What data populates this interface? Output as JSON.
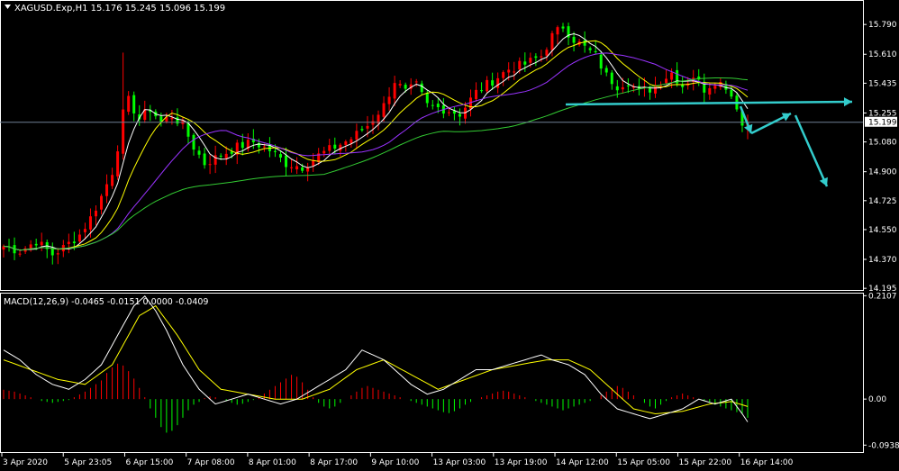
{
  "chart_data": [
    {
      "type": "candlestick",
      "title": "XAGUSD.Exp,H1  15.176 15.245 15.096 15.199",
      "symbol": "XAGUSD.Exp",
      "timeframe": "H1",
      "ohlc_last": {
        "open": 15.176,
        "high": 15.245,
        "low": 15.096,
        "close": 15.199
      },
      "current_price_label": "15.199",
      "current_price": 15.199,
      "y_ticks": [
        "15.790",
        "15.610",
        "15.435",
        "15.255",
        "15.080",
        "14.900",
        "14.725",
        "14.550",
        "14.370",
        "14.195"
      ],
      "y_tick_values": [
        15.79,
        15.61,
        15.435,
        15.255,
        15.08,
        14.9,
        14.725,
        14.55,
        14.37,
        14.195
      ],
      "ylim": [
        14.185,
        15.84
      ],
      "x_tick_labels": [
        "3 Apr 2020",
        "5 Apr 23:05",
        "6 Apr 15:00",
        "7 Apr 08:00",
        "8 Apr 01:00",
        "8 Apr 17:00",
        "9 Apr 10:00",
        "13 Apr 03:00",
        "13 Apr 19:00",
        "14 Apr 12:00",
        "15 Apr 05:00",
        "15 Apr 22:00",
        "16 Apr 14:00"
      ],
      "bull_color": "#ff0000",
      "bear_color": "#00ff00",
      "ma_colors": [
        "#ffffff",
        "#ffff00",
        "#9933ff",
        "#33cc33"
      ],
      "annotation_color": "#33cccc",
      "close_path": [
        [
          0,
          14.45
        ],
        [
          3,
          14.42
        ],
        [
          6,
          14.48
        ],
        [
          9,
          14.4
        ],
        [
          11,
          14.44
        ],
        [
          14,
          14.52
        ],
        [
          16,
          14.62
        ],
        [
          18,
          14.75
        ],
        [
          20,
          14.9
        ],
        [
          21,
          15.05
        ],
        [
          22,
          15.25
        ],
        [
          23,
          15.33
        ],
        [
          25,
          15.22
        ],
        [
          27,
          15.28
        ],
        [
          29,
          15.2
        ],
        [
          31,
          15.24
        ],
        [
          33,
          15.18
        ],
        [
          35,
          15.05
        ],
        [
          37,
          14.95
        ],
        [
          40,
          15.0
        ],
        [
          43,
          15.05
        ],
        [
          46,
          15.08
        ],
        [
          49,
          15.03
        ],
        [
          52,
          14.95
        ],
        [
          55,
          14.93
        ],
        [
          58,
          15.0
        ],
        [
          61,
          15.05
        ],
        [
          64,
          15.1
        ],
        [
          67,
          15.18
        ],
        [
          70,
          15.3
        ],
        [
          72,
          15.45
        ],
        [
          74,
          15.38
        ],
        [
          76,
          15.42
        ],
        [
          78,
          15.3
        ],
        [
          81,
          15.28
        ],
        [
          84,
          15.25
        ],
        [
          87,
          15.38
        ],
        [
          90,
          15.45
        ],
        [
          93,
          15.52
        ],
        [
          96,
          15.55
        ],
        [
          99,
          15.6
        ],
        [
          101,
          15.72
        ],
        [
          103,
          15.78
        ],
        [
          105,
          15.7
        ],
        [
          107,
          15.65
        ],
        [
          109,
          15.6
        ],
        [
          111,
          15.48
        ],
        [
          113,
          15.42
        ],
        [
          115,
          15.45
        ],
        [
          117,
          15.38
        ],
        [
          119,
          15.4
        ],
        [
          121,
          15.45
        ],
        [
          123,
          15.5
        ],
        [
          125,
          15.42
        ],
        [
          127,
          15.48
        ],
        [
          129,
          15.4
        ],
        [
          131,
          15.45
        ],
        [
          133,
          15.42
        ],
        [
          135,
          15.3
        ],
        [
          136,
          15.18
        ],
        [
          137,
          15.199
        ]
      ]
    },
    {
      "type": "macd",
      "label": "MACD(12,26,9) -0.0465 -0.0151 0.0000 -0.0409",
      "y_ticks": [
        "0.2107",
        "0.00",
        "-0.0938"
      ],
      "y_tick_values": [
        0.2107,
        0.0,
        -0.0938
      ],
      "ylim": [
        -0.108,
        0.215
      ],
      "main_color": "#ffffff",
      "signal_color": "#ffff00",
      "hist_up_color": "#ff0000",
      "hist_down_color": "#00ff00",
      "main_path": [
        [
          0,
          0.1
        ],
        [
          3,
          0.08
        ],
        [
          6,
          0.05
        ],
        [
          9,
          0.03
        ],
        [
          12,
          0.02
        ],
        [
          15,
          0.04
        ],
        [
          18,
          0.07
        ],
        [
          21,
          0.13
        ],
        [
          24,
          0.19
        ],
        [
          26,
          0.21
        ],
        [
          28,
          0.18
        ],
        [
          30,
          0.14
        ],
        [
          33,
          0.07
        ],
        [
          36,
          0.02
        ],
        [
          39,
          -0.01
        ],
        [
          42,
          0.0
        ],
        [
          45,
          0.01
        ],
        [
          48,
          0.0
        ],
        [
          51,
          -0.01
        ],
        [
          54,
          0.0
        ],
        [
          57,
          0.02
        ],
        [
          60,
          0.04
        ],
        [
          63,
          0.06
        ],
        [
          66,
          0.1
        ],
        [
          68,
          0.09
        ],
        [
          70,
          0.08
        ],
        [
          72,
          0.06
        ],
        [
          75,
          0.03
        ],
        [
          78,
          0.01
        ],
        [
          81,
          0.02
        ],
        [
          84,
          0.04
        ],
        [
          87,
          0.06
        ],
        [
          90,
          0.06
        ],
        [
          93,
          0.07
        ],
        [
          96,
          0.08
        ],
        [
          99,
          0.09
        ],
        [
          101,
          0.08
        ],
        [
          104,
          0.07
        ],
        [
          107,
          0.05
        ],
        [
          110,
          0.01
        ],
        [
          113,
          -0.02
        ],
        [
          116,
          -0.03
        ],
        [
          119,
          -0.04
        ],
        [
          122,
          -0.03
        ],
        [
          125,
          -0.02
        ],
        [
          128,
          0.0
        ],
        [
          131,
          -0.01
        ],
        [
          134,
          0.0
        ],
        [
          136,
          -0.03
        ],
        [
          137,
          -0.0465
        ]
      ],
      "signal_path": [
        [
          0,
          0.08
        ],
        [
          5,
          0.06
        ],
        [
          10,
          0.04
        ],
        [
          15,
          0.03
        ],
        [
          20,
          0.07
        ],
        [
          25,
          0.17
        ],
        [
          28,
          0.19
        ],
        [
          32,
          0.13
        ],
        [
          36,
          0.06
        ],
        [
          40,
          0.02
        ],
        [
          45,
          0.01
        ],
        [
          50,
          0.0
        ],
        [
          55,
          0.0
        ],
        [
          60,
          0.02
        ],
        [
          65,
          0.06
        ],
        [
          70,
          0.08
        ],
        [
          75,
          0.05
        ],
        [
          80,
          0.02
        ],
        [
          85,
          0.04
        ],
        [
          90,
          0.06
        ],
        [
          95,
          0.07
        ],
        [
          100,
          0.08
        ],
        [
          104,
          0.08
        ],
        [
          108,
          0.06
        ],
        [
          112,
          0.02
        ],
        [
          116,
          -0.02
        ],
        [
          120,
          -0.03
        ],
        [
          125,
          -0.025
        ],
        [
          130,
          -0.01
        ],
        [
          134,
          -0.005
        ],
        [
          137,
          -0.0151
        ]
      ],
      "histogram": [
        0.01,
        0.009,
        0.008,
        0.006,
        0.004,
        0.002,
        0.0,
        -0.002,
        -0.003,
        -0.004,
        -0.003,
        -0.002,
        -0.001,
        0.002,
        0.005,
        0.008,
        0.012,
        0.016,
        0.02,
        0.028,
        0.034,
        0.038,
        0.036,
        0.03,
        0.022,
        0.012,
        0.002,
        -0.01,
        -0.02,
        -0.03,
        -0.036,
        -0.034,
        -0.028,
        -0.02,
        -0.012,
        -0.006,
        -0.003,
        0.001,
        0.003,
        0.002,
        0.0,
        -0.002,
        -0.004,
        -0.006,
        -0.005,
        -0.003,
        -0.001,
        0.002,
        0.006,
        0.01,
        0.014,
        0.018,
        0.022,
        0.026,
        0.024,
        0.018,
        0.01,
        0.002,
        -0.004,
        -0.008,
        -0.01,
        -0.008,
        -0.004,
        0.0,
        0.004,
        0.008,
        0.012,
        0.014,
        0.012,
        0.01,
        0.008,
        0.006,
        0.004,
        0.002,
        0.0,
        -0.002,
        -0.004,
        -0.006,
        -0.008,
        -0.01,
        -0.012,
        -0.014,
        -0.015,
        -0.013,
        -0.01,
        -0.006,
        -0.003,
        0.0,
        0.002,
        0.004,
        0.006,
        0.008,
        0.009,
        0.008,
        0.006,
        0.004,
        0.002,
        0.0,
        -0.002,
        -0.004,
        -0.006,
        -0.008,
        -0.01,
        -0.012,
        -0.01,
        -0.008,
        -0.006,
        -0.004,
        -0.002,
        0.0,
        0.004,
        0.008,
        0.012,
        0.014,
        0.012,
        0.008,
        0.004,
        0.0,
        -0.004,
        -0.008,
        -0.01,
        -0.006,
        -0.002,
        0.002,
        0.004,
        0.006,
        0.004,
        0.002,
        0.0,
        -0.002,
        -0.004,
        -0.006,
        -0.008,
        -0.01,
        -0.012,
        -0.014,
        -0.016,
        -0.02
      ]
    }
  ]
}
